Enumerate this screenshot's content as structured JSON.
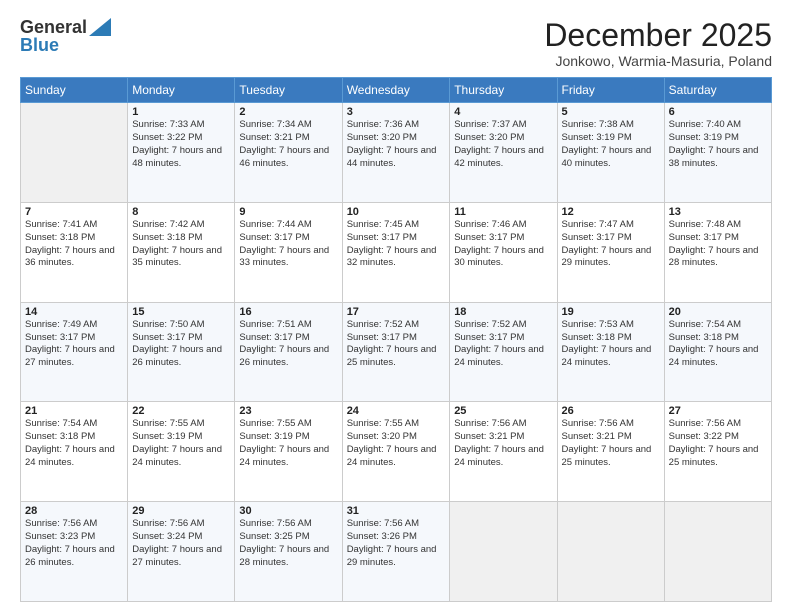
{
  "header": {
    "logo_general": "General",
    "logo_blue": "Blue",
    "month_title": "December 2025",
    "location": "Jonkowo, Warmia-Masuria, Poland"
  },
  "days_of_week": [
    "Sunday",
    "Monday",
    "Tuesday",
    "Wednesday",
    "Thursday",
    "Friday",
    "Saturday"
  ],
  "weeks": [
    [
      {
        "day": "",
        "info": ""
      },
      {
        "day": "1",
        "info": "Sunrise: 7:33 AM\nSunset: 3:22 PM\nDaylight: 7 hours\nand 48 minutes."
      },
      {
        "day": "2",
        "info": "Sunrise: 7:34 AM\nSunset: 3:21 PM\nDaylight: 7 hours\nand 46 minutes."
      },
      {
        "day": "3",
        "info": "Sunrise: 7:36 AM\nSunset: 3:20 PM\nDaylight: 7 hours\nand 44 minutes."
      },
      {
        "day": "4",
        "info": "Sunrise: 7:37 AM\nSunset: 3:20 PM\nDaylight: 7 hours\nand 42 minutes."
      },
      {
        "day": "5",
        "info": "Sunrise: 7:38 AM\nSunset: 3:19 PM\nDaylight: 7 hours\nand 40 minutes."
      },
      {
        "day": "6",
        "info": "Sunrise: 7:40 AM\nSunset: 3:19 PM\nDaylight: 7 hours\nand 38 minutes."
      }
    ],
    [
      {
        "day": "7",
        "info": "Sunrise: 7:41 AM\nSunset: 3:18 PM\nDaylight: 7 hours\nand 36 minutes."
      },
      {
        "day": "8",
        "info": "Sunrise: 7:42 AM\nSunset: 3:18 PM\nDaylight: 7 hours\nand 35 minutes."
      },
      {
        "day": "9",
        "info": "Sunrise: 7:44 AM\nSunset: 3:17 PM\nDaylight: 7 hours\nand 33 minutes."
      },
      {
        "day": "10",
        "info": "Sunrise: 7:45 AM\nSunset: 3:17 PM\nDaylight: 7 hours\nand 32 minutes."
      },
      {
        "day": "11",
        "info": "Sunrise: 7:46 AM\nSunset: 3:17 PM\nDaylight: 7 hours\nand 30 minutes."
      },
      {
        "day": "12",
        "info": "Sunrise: 7:47 AM\nSunset: 3:17 PM\nDaylight: 7 hours\nand 29 minutes."
      },
      {
        "day": "13",
        "info": "Sunrise: 7:48 AM\nSunset: 3:17 PM\nDaylight: 7 hours\nand 28 minutes."
      }
    ],
    [
      {
        "day": "14",
        "info": "Sunrise: 7:49 AM\nSunset: 3:17 PM\nDaylight: 7 hours\nand 27 minutes."
      },
      {
        "day": "15",
        "info": "Sunrise: 7:50 AM\nSunset: 3:17 PM\nDaylight: 7 hours\nand 26 minutes."
      },
      {
        "day": "16",
        "info": "Sunrise: 7:51 AM\nSunset: 3:17 PM\nDaylight: 7 hours\nand 26 minutes."
      },
      {
        "day": "17",
        "info": "Sunrise: 7:52 AM\nSunset: 3:17 PM\nDaylight: 7 hours\nand 25 minutes."
      },
      {
        "day": "18",
        "info": "Sunrise: 7:52 AM\nSunset: 3:17 PM\nDaylight: 7 hours\nand 24 minutes."
      },
      {
        "day": "19",
        "info": "Sunrise: 7:53 AM\nSunset: 3:18 PM\nDaylight: 7 hours\nand 24 minutes."
      },
      {
        "day": "20",
        "info": "Sunrise: 7:54 AM\nSunset: 3:18 PM\nDaylight: 7 hours\nand 24 minutes."
      }
    ],
    [
      {
        "day": "21",
        "info": "Sunrise: 7:54 AM\nSunset: 3:18 PM\nDaylight: 7 hours\nand 24 minutes."
      },
      {
        "day": "22",
        "info": "Sunrise: 7:55 AM\nSunset: 3:19 PM\nDaylight: 7 hours\nand 24 minutes."
      },
      {
        "day": "23",
        "info": "Sunrise: 7:55 AM\nSunset: 3:19 PM\nDaylight: 7 hours\nand 24 minutes."
      },
      {
        "day": "24",
        "info": "Sunrise: 7:55 AM\nSunset: 3:20 PM\nDaylight: 7 hours\nand 24 minutes."
      },
      {
        "day": "25",
        "info": "Sunrise: 7:56 AM\nSunset: 3:21 PM\nDaylight: 7 hours\nand 24 minutes."
      },
      {
        "day": "26",
        "info": "Sunrise: 7:56 AM\nSunset: 3:21 PM\nDaylight: 7 hours\nand 25 minutes."
      },
      {
        "day": "27",
        "info": "Sunrise: 7:56 AM\nSunset: 3:22 PM\nDaylight: 7 hours\nand 25 minutes."
      }
    ],
    [
      {
        "day": "28",
        "info": "Sunrise: 7:56 AM\nSunset: 3:23 PM\nDaylight: 7 hours\nand 26 minutes."
      },
      {
        "day": "29",
        "info": "Sunrise: 7:56 AM\nSunset: 3:24 PM\nDaylight: 7 hours\nand 27 minutes."
      },
      {
        "day": "30",
        "info": "Sunrise: 7:56 AM\nSunset: 3:25 PM\nDaylight: 7 hours\nand 28 minutes."
      },
      {
        "day": "31",
        "info": "Sunrise: 7:56 AM\nSunset: 3:26 PM\nDaylight: 7 hours\nand 29 minutes."
      },
      {
        "day": "",
        "info": ""
      },
      {
        "day": "",
        "info": ""
      },
      {
        "day": "",
        "info": ""
      }
    ]
  ]
}
